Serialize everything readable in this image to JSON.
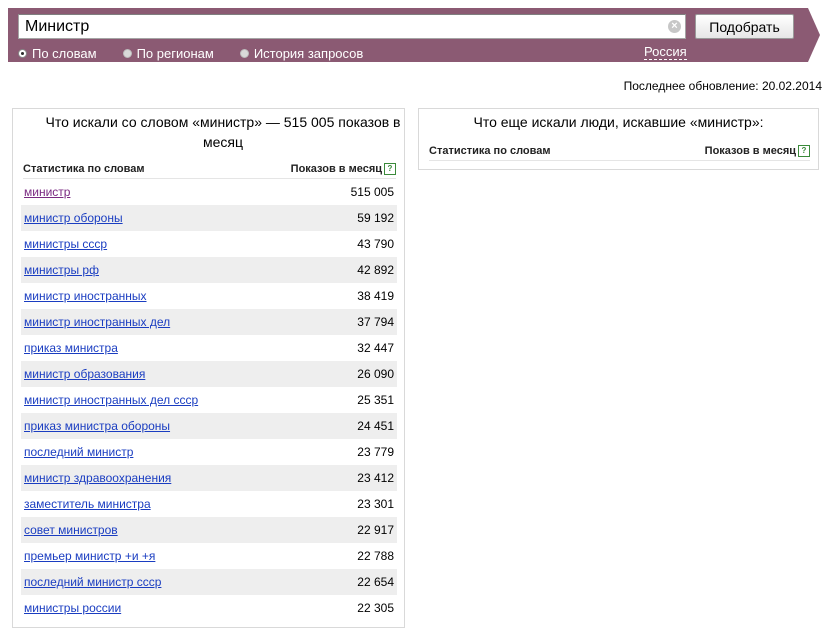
{
  "search": {
    "query": "Министр",
    "submit_label": "Подобрать"
  },
  "modes": [
    {
      "label": "По словам",
      "selected": true
    },
    {
      "label": "По регионам",
      "selected": false
    },
    {
      "label": "История запросов",
      "selected": false
    }
  ],
  "region": "Россия",
  "updated": "Последнее обновление: 20.02.2014",
  "left_panel": {
    "title": "Что искали со словом «министр» — 515 005 показов в месяц",
    "col_stat": "Статистика по словам",
    "col_count": "Показов в месяц",
    "help": "?",
    "rows": [
      {
        "phrase": "министр",
        "count": "515 005"
      },
      {
        "phrase": "министр обороны",
        "count": "59 192"
      },
      {
        "phrase": "министры ссср",
        "count": "43 790"
      },
      {
        "phrase": "министры рф",
        "count": "42 892"
      },
      {
        "phrase": "министр иностранных",
        "count": "38 419"
      },
      {
        "phrase": "министр иностранных дел",
        "count": "37 794"
      },
      {
        "phrase": "приказ министра",
        "count": "32 447"
      },
      {
        "phrase": "министр образования",
        "count": "26 090"
      },
      {
        "phrase": "министр иностранных дел ссср",
        "count": "25 351"
      },
      {
        "phrase": "приказ министра обороны",
        "count": "24 451"
      },
      {
        "phrase": "последний министр",
        "count": "23 779"
      },
      {
        "phrase": "министр здравоохранения",
        "count": "23 412"
      },
      {
        "phrase": "заместитель министра",
        "count": "23 301"
      },
      {
        "phrase": "совет министров",
        "count": "22 917"
      },
      {
        "phrase": "премьер министр +и +я",
        "count": "22 788"
      },
      {
        "phrase": "последний министр ссср",
        "count": "22 654"
      },
      {
        "phrase": "министры россии",
        "count": "22 305"
      }
    ]
  },
  "right_panel": {
    "title": "Что еще искали люди, искавшие «министр»:",
    "col_stat": "Статистика по словам",
    "col_count": "Показов в месяц",
    "help": "?"
  },
  "colors": {
    "band": "#8b5a73",
    "link": "#1a3dc1",
    "link_visited": "#7a2a82",
    "row_alt": "#eeeeee"
  },
  "icons": [
    "clear-icon",
    "help-icon"
  ]
}
